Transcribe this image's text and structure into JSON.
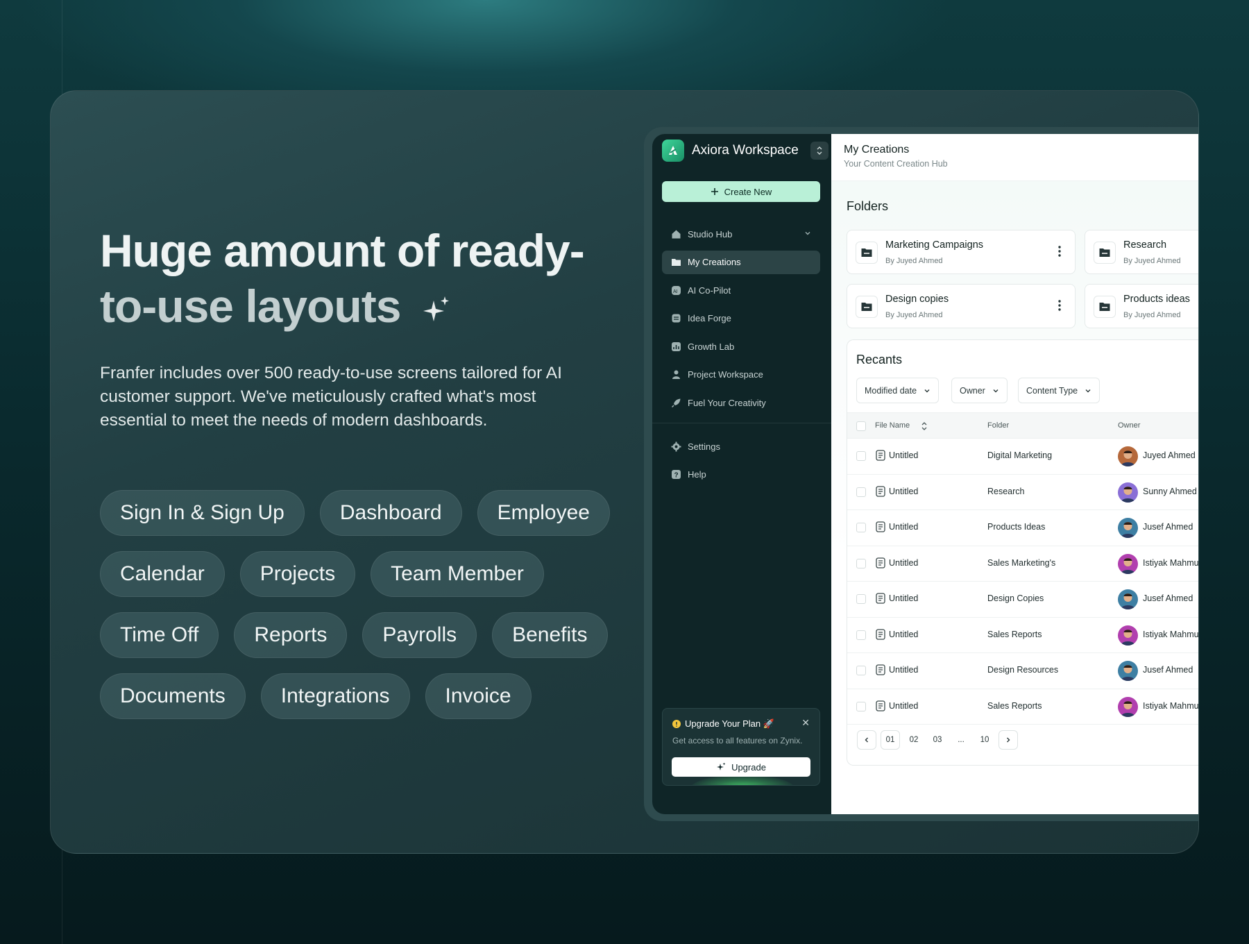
{
  "hero": {
    "headline_line1": "Huge amount of ready-",
    "headline_line2": "to-use layouts",
    "description": "Franfer includes over 500 ready-to-use screens tailored for AI customer support. We've meticulously crafted what's most essential to meet the needs of modern dashboards.",
    "pill_rows": [
      [
        "Sign In & Sign Up",
        "Dashboard",
        "Employee"
      ],
      [
        "Calendar",
        "Projects",
        "Team Member"
      ],
      [
        "Time Off",
        "Reports",
        "Payrolls",
        "Benefits"
      ],
      [
        "Documents",
        "Integrations",
        "Invoice"
      ]
    ]
  },
  "app": {
    "workspace_name": "Axiora Workspace",
    "create_new_label": "Create New",
    "nav_items": [
      {
        "label": "Studio Hub",
        "icon": "home-icon"
      },
      {
        "label": "My Creations",
        "icon": "folder-icon",
        "active": true
      },
      {
        "label": "AI Co-Pilot",
        "icon": "ai-icon"
      },
      {
        "label": "Idea Forge",
        "icon": "cube-icon"
      },
      {
        "label": "Growth Lab",
        "icon": "chart-icon"
      },
      {
        "label": "Project Workspace",
        "icon": "team-icon"
      },
      {
        "label": "Fuel Your Creativity",
        "icon": "rocket-icon"
      }
    ],
    "nav_secondary": [
      {
        "label": "Settings",
        "icon": "gear-icon"
      },
      {
        "label": "Help",
        "icon": "help-icon"
      }
    ],
    "upgrade": {
      "title": "Upgrade Your Plan 🚀",
      "text": "Get access to all features on Zynix.",
      "button": "Upgrade"
    },
    "main": {
      "title": "My Creations",
      "subtitle": "Your Content Creation Hub",
      "folders_title": "Folders",
      "folders": [
        {
          "name": "Marketing Campaigns",
          "by": "By Juyed Ahmed"
        },
        {
          "name": "Research",
          "by": "By Juyed Ahmed"
        },
        {
          "name": "Design copies",
          "by": "By Juyed Ahmed"
        },
        {
          "name": "Products ideas",
          "by": "By Juyed Ahmed"
        }
      ],
      "recents_title": "Recants",
      "filters": [
        "Modified date",
        "Owner",
        "Content Type"
      ],
      "columns": [
        "File Name",
        "Folder",
        "Owner"
      ],
      "rows": [
        {
          "file": "Untitled",
          "folder": "Digital Marketing",
          "owner": "Juyed Ahmed",
          "avatar_color": "#b5683a"
        },
        {
          "file": "Untitled",
          "folder": "Research",
          "owner": "Sunny Ahmed",
          "avatar_color": "#8a6fd6"
        },
        {
          "file": "Untitled",
          "folder": "Products Ideas",
          "owner": "Jusef Ahmed",
          "avatar_color": "#3e7fa3"
        },
        {
          "file": "Untitled",
          "folder": "Sales Marketing's",
          "owner": "Istiyak Mahmud",
          "avatar_color": "#b13fae"
        },
        {
          "file": "Untitled",
          "folder": "Design Copies",
          "owner": "Jusef Ahmed",
          "avatar_color": "#3e7fa3"
        },
        {
          "file": "Untitled",
          "folder": "Sales Reports",
          "owner": "Istiyak Mahmud",
          "avatar_color": "#b13fae"
        },
        {
          "file": "Untitled",
          "folder": "Design Resources",
          "owner": "Jusef Ahmed",
          "avatar_color": "#3e7fa3"
        },
        {
          "file": "Untitled",
          "folder": "Sales Reports",
          "owner": "Istiyak Mahmud",
          "avatar_color": "#b13fae"
        }
      ],
      "pagination": [
        "01",
        "02",
        "03",
        "...",
        "10"
      ]
    }
  }
}
